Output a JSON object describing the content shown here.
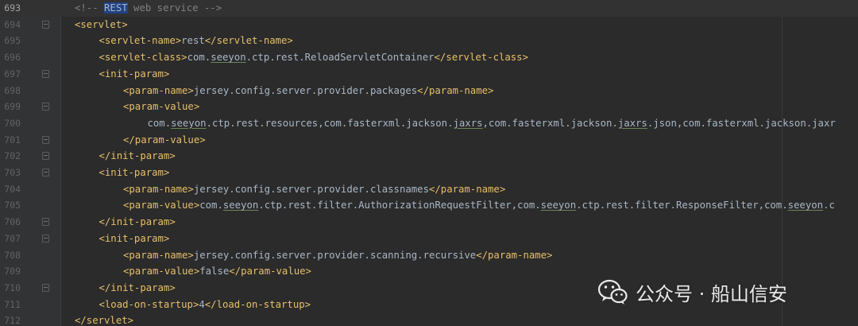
{
  "editor": {
    "lines": [
      {
        "number": "693",
        "parts": [
          {
            "t": "<!-- ",
            "c": "cmt"
          },
          {
            "t": "REST",
            "c": "hl"
          },
          {
            "t": " web service -->",
            "c": "cmt"
          }
        ]
      },
      {
        "number": "694",
        "parts": [
          {
            "t": "<servlet>",
            "c": "tag"
          }
        ]
      },
      {
        "number": "695",
        "parts": [
          {
            "t": "<servlet-name>",
            "c": "tag"
          },
          {
            "t": "rest",
            "c": "txt"
          },
          {
            "t": "</servlet-name>",
            "c": "tag"
          }
        ]
      },
      {
        "number": "696",
        "parts": [
          {
            "t": "<servlet-class>",
            "c": "tag"
          },
          {
            "t": "com.",
            "c": "txt"
          },
          {
            "t": "seeyon",
            "c": "under"
          },
          {
            "t": ".ctp.rest.ReloadServletContainer",
            "c": "txt"
          },
          {
            "t": "</servlet-class>",
            "c": "tag"
          }
        ]
      },
      {
        "number": "697",
        "parts": [
          {
            "t": "<init-param>",
            "c": "tag"
          }
        ]
      },
      {
        "number": "698",
        "parts": [
          {
            "t": "<param-name>",
            "c": "tag"
          },
          {
            "t": "jersey.config.server.provider.packages",
            "c": "txt"
          },
          {
            "t": "</param-name>",
            "c": "tag"
          }
        ]
      },
      {
        "number": "699",
        "parts": [
          {
            "t": "<param-value>",
            "c": "tag"
          }
        ]
      },
      {
        "number": "700",
        "parts": [
          {
            "t": "com.",
            "c": "txt"
          },
          {
            "t": "seeyon",
            "c": "under"
          },
          {
            "t": ".ctp.rest.resources,com.fasterxml.jackson.",
            "c": "txt"
          },
          {
            "t": "jaxrs",
            "c": "under"
          },
          {
            "t": ",com.fasterxml.jackson.",
            "c": "txt"
          },
          {
            "t": "jaxrs",
            "c": "under"
          },
          {
            "t": ".json,com.fasterxml.jackson.jaxr",
            "c": "txt"
          }
        ]
      },
      {
        "number": "701",
        "parts": [
          {
            "t": "</param-value>",
            "c": "tag"
          }
        ]
      },
      {
        "number": "702",
        "parts": [
          {
            "t": "</init-param>",
            "c": "tag"
          }
        ]
      },
      {
        "number": "703",
        "parts": [
          {
            "t": "<init-param>",
            "c": "tag"
          }
        ]
      },
      {
        "number": "704",
        "parts": [
          {
            "t": "<param-name>",
            "c": "tag"
          },
          {
            "t": "jersey.config.server.provider.classnames",
            "c": "txt"
          },
          {
            "t": "</param-name>",
            "c": "tag"
          }
        ]
      },
      {
        "number": "705",
        "parts": [
          {
            "t": "<param-value>",
            "c": "tag"
          },
          {
            "t": "com.",
            "c": "txt"
          },
          {
            "t": "seeyon",
            "c": "under"
          },
          {
            "t": ".ctp.rest.filter.AuthorizationRequestFilter,com.",
            "c": "txt"
          },
          {
            "t": "seeyon",
            "c": "under"
          },
          {
            "t": ".ctp.rest.filter.ResponseFilter,com.",
            "c": "txt"
          },
          {
            "t": "seeyon",
            "c": "under"
          },
          {
            "t": ".c",
            "c": "txt"
          }
        ]
      },
      {
        "number": "706",
        "parts": [
          {
            "t": "</init-param>",
            "c": "tag"
          }
        ]
      },
      {
        "number": "707",
        "parts": [
          {
            "t": "<init-param>",
            "c": "tag"
          }
        ]
      },
      {
        "number": "708",
        "parts": [
          {
            "t": "<param-name>",
            "c": "tag"
          },
          {
            "t": "jersey.config.server.provider.scanning.recursive",
            "c": "txt"
          },
          {
            "t": "</param-name>",
            "c": "tag"
          }
        ]
      },
      {
        "number": "709",
        "parts": [
          {
            "t": "<param-value>",
            "c": "tag"
          },
          {
            "t": "false",
            "c": "txt"
          },
          {
            "t": "</param-value>",
            "c": "tag"
          }
        ]
      },
      {
        "number": "710",
        "parts": [
          {
            "t": "</init-param>",
            "c": "tag"
          }
        ]
      },
      {
        "number": "711",
        "parts": [
          {
            "t": "<load-on-startup>",
            "c": "tag"
          },
          {
            "t": "4",
            "c": "txt"
          },
          {
            "t": "</load-on-startup>",
            "c": "tag"
          }
        ]
      },
      {
        "number": "712",
        "parts": [
          {
            "t": "</servlet>",
            "c": "tag"
          }
        ]
      }
    ]
  },
  "watermark": {
    "text": "公众号 · 船山信安",
    "icon": "wechat-icon"
  },
  "colors": {
    "background": "#2b2b2b",
    "tag": "#e8bf6a",
    "text": "#a9b7c6",
    "comment": "#808080",
    "selection": "#214283"
  }
}
